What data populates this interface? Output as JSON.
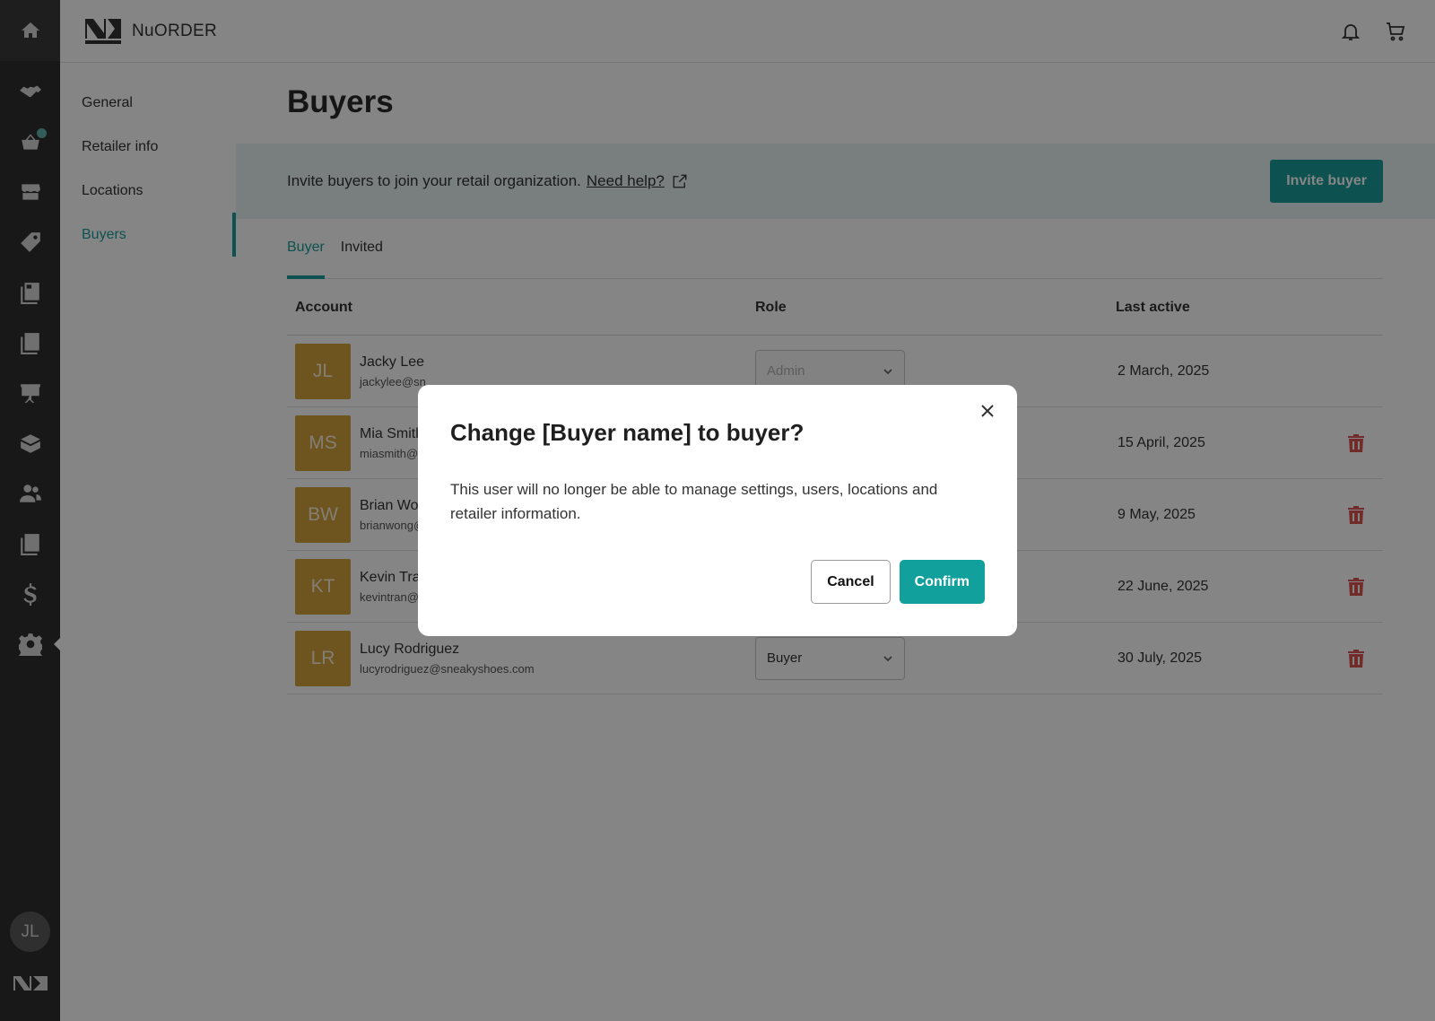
{
  "app": {
    "brand": "NuORDER",
    "avatar_initials": "JL"
  },
  "subnav": {
    "items": [
      {
        "label": "General"
      },
      {
        "label": "Retailer info"
      },
      {
        "label": "Locations"
      },
      {
        "label": "Buyers"
      }
    ],
    "active": "Buyers"
  },
  "page": {
    "title": "Buyers",
    "banner_text": "Invite buyers to join your retail organization.",
    "help_link": "Need help?",
    "invite_button": "Invite buyer"
  },
  "tabs": [
    {
      "label": "Buyer",
      "active": true
    },
    {
      "label": "Invited",
      "active": false
    }
  ],
  "table": {
    "headers": {
      "account": "Account",
      "role": "Role",
      "last_active": "Last active"
    },
    "rows": [
      {
        "initials": "JL",
        "name": "Jacky Lee",
        "email": "jackylee@sn",
        "role": "Admin",
        "last_active": "2 March, 2025",
        "deletable": false
      },
      {
        "initials": "MS",
        "name": "Mia Smitl",
        "email": "miasmith@s",
        "role": "",
        "last_active": "15 April, 2025",
        "deletable": true
      },
      {
        "initials": "BW",
        "name": "Brian Wo",
        "email": "brianwong@",
        "role": "",
        "last_active": "9 May, 2025",
        "deletable": true
      },
      {
        "initials": "KT",
        "name": "Kevin Tra",
        "email": "kevintran@",
        "role": "",
        "last_active": "22 June, 2025",
        "deletable": true
      },
      {
        "initials": "LR",
        "name": "Lucy Rodriguez",
        "email": "lucyrodriguez@sneakyshoes.com",
        "role": "Buyer",
        "last_active": "30 July, 2025",
        "deletable": true
      }
    ]
  },
  "modal": {
    "title": "Change [Buyer name] to buyer?",
    "body": "This user will no longer be able to manage settings, users, locations and retailer information.",
    "cancel": "Cancel",
    "confirm": "Confirm"
  },
  "colors": {
    "accent": "#1a9e9a",
    "avatar": "#d4a23c",
    "danger": "#d9534f",
    "rail": "#2f2f2f"
  }
}
